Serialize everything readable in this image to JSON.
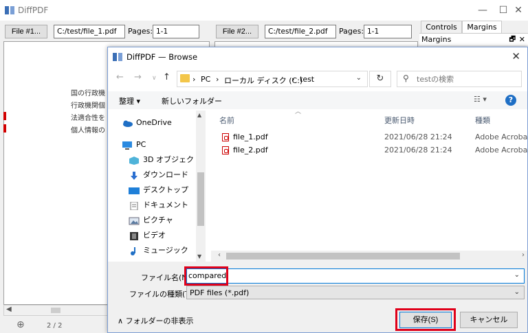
{
  "app": {
    "title": "DiffPDF",
    "window_controls": {
      "minimize": "—",
      "maximize": "☐",
      "close": "✕"
    }
  },
  "toolbar": {
    "file1_button": "File #1...",
    "file1_path": "C:/test/file_1.pdf",
    "pages_label": "Pages:",
    "file1_pages": "1-1",
    "file2_button": "File #2...",
    "file2_path": "C:/test/file_2.pdf",
    "file2_pages": "1-1"
  },
  "dock": {
    "tabs": [
      "Controls",
      "Margins"
    ],
    "active_tab": "Margins",
    "header": "Margins"
  },
  "left_pane": {
    "lines": [
      "国の行政機",
      "行政機関個",
      "法適合性を",
      "個人情報の"
    ]
  },
  "bottom_bar": {
    "page_text": "2  /  2"
  },
  "dialog": {
    "title": "DiffPDF — Browse",
    "breadcrumb": [
      "PC",
      "ローカル ディスク (C:)",
      "test"
    ],
    "search_placeholder": "testの検索",
    "commands": {
      "organize": "整理 ▾",
      "new_folder": "新しいフォルダー"
    },
    "nav_items": [
      {
        "label": "OneDrive",
        "icon": "cloud-icon"
      },
      {
        "label": "PC",
        "icon": "computer-icon"
      },
      {
        "label": "3D オブジェクト",
        "icon": "cube-icon"
      },
      {
        "label": "ダウンロード",
        "icon": "download-icon"
      },
      {
        "label": "デスクトップ",
        "icon": "desktop-icon"
      },
      {
        "label": "ドキュメント",
        "icon": "document-icon"
      },
      {
        "label": "ピクチャ",
        "icon": "picture-icon"
      },
      {
        "label": "ビデオ",
        "icon": "video-icon"
      },
      {
        "label": "ミュージック",
        "icon": "music-icon"
      }
    ],
    "columns": {
      "name": "名前",
      "modified": "更新日時",
      "type": "種類"
    },
    "files": [
      {
        "name": "file_1.pdf",
        "modified": "2021/06/28 21:24",
        "type": "Adobe Acrobat D"
      },
      {
        "name": "file_2.pdf",
        "modified": "2021/06/28 21:24",
        "type": "Adobe Acrobat D"
      }
    ],
    "filename_label": "ファイル名(N):",
    "filename_value": "compared",
    "filetype_label": "ファイルの種類(T):",
    "filetype_value": "PDF files (*.pdf)",
    "hide_folders": "フォルダーの非表示",
    "save_button": "保存(S)",
    "cancel_button": "キャンセル"
  },
  "colors": {
    "highlight": "#e0001a",
    "accent": "#0078d7",
    "pdf_icon": "#cc0000"
  }
}
